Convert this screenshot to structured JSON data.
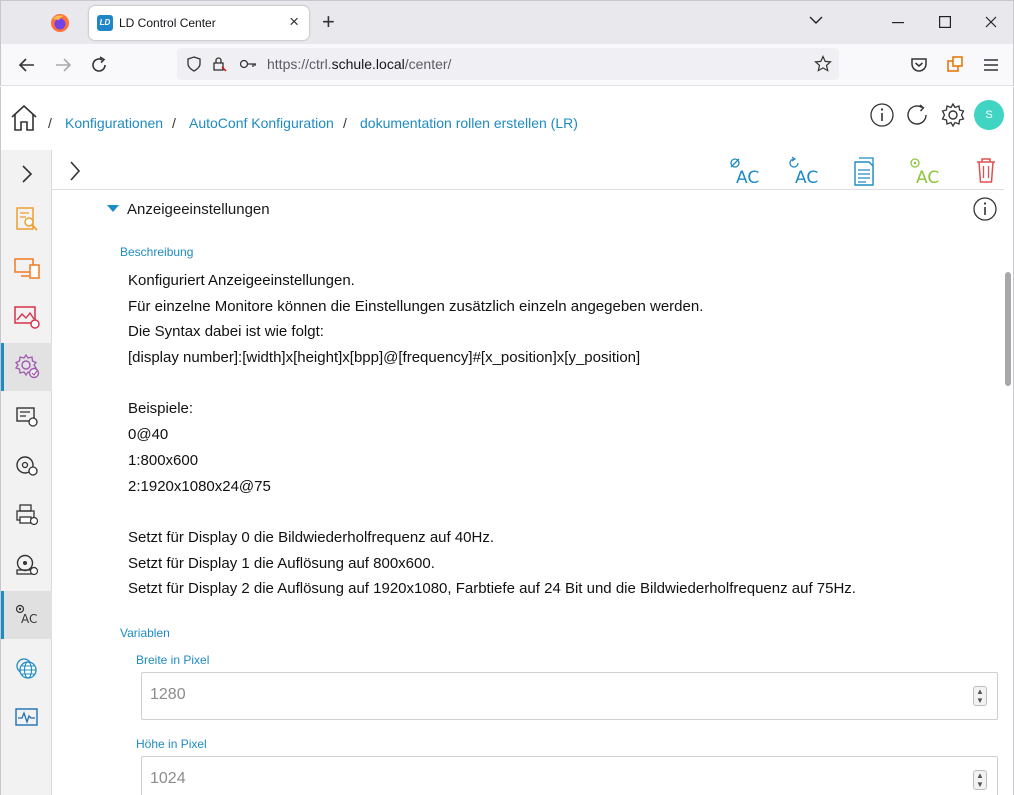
{
  "browser": {
    "tab_title": "LD Control Center",
    "tab_favicon_text": "LD",
    "new_tab_symbol": "+",
    "url_prefix": "https://ctrl.",
    "url_domain": "schule.local",
    "url_path": "/center/"
  },
  "breadcrumb": {
    "items": [
      "Konfigurationen",
      "AutoConf Konfiguration",
      "dokumentation rollen erstellen (LR)"
    ],
    "separator": "/"
  },
  "user": {
    "avatar_letter": "S"
  },
  "section": {
    "title": "Anzeigeeinstellungen",
    "description_label": "Beschreibung",
    "description_lines": [
      "Konfiguriert Anzeigeeinstellungen.",
      "Für einzelne Monitore können die Einstellungen zusätzlich einzeln angegeben werden.",
      "Die Syntax dabei ist wie folgt:",
      "[display number]:[width]x[height]x[bpp]@[frequency]#[x_position]x[y_position]",
      "",
      "Beispiele:",
      "0@40",
      "1:800x600",
      "2:1920x1080x24@75",
      "",
      "Setzt für Display 0 die Bildwiederholfrequenz auf 40Hz.",
      "Setzt für Display 1 die Auflösung auf 800x600.",
      "Setzt für Display 2 die Auflösung auf 1920x1080, Farbtiefe auf 24 Bit und die Bildwiederholfrequenz auf 75Hz."
    ],
    "variables_label": "Variablen",
    "fields": [
      {
        "label": "Breite in Pixel",
        "value": "1280"
      },
      {
        "label": "Höhe in Pixel",
        "value": "1024"
      }
    ]
  },
  "colors": {
    "accent": "#1e8bc3",
    "toolbar_green": "#8cc63f",
    "delete_red": "#e05050"
  },
  "toolbar_icons": [
    "ac-deactivate-icon",
    "ac-reset-icon",
    "document-icon",
    "ac-activate-icon",
    "trash-icon"
  ],
  "toolbar_ac_text": "AC",
  "sidebar_ac_text": "AC"
}
